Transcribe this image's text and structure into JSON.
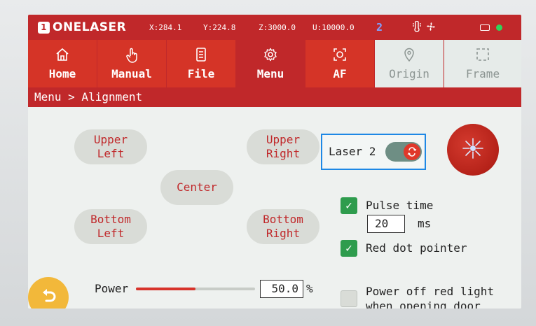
{
  "brand": {
    "logo_text": "ONELASER",
    "logo_badge": "1"
  },
  "status": {
    "x": "X:284.1",
    "y": "Y:224.8",
    "z": "Z:3000.0",
    "u": "U:10000.0",
    "laser_number": "2",
    "icons": [
      "temperature-icon",
      "fan-icon",
      "battery-icon",
      "connection-dot"
    ],
    "connection_color": "#2fd35a"
  },
  "tabs": [
    {
      "label": "Home",
      "icon": "home-icon"
    },
    {
      "label": "Manual",
      "icon": "hand-pointer-icon"
    },
    {
      "label": "File",
      "icon": "file-icon"
    },
    {
      "label": "Menu",
      "icon": "gear-icon",
      "active": true
    },
    {
      "label": "AF",
      "icon": "autofocus-icon"
    },
    {
      "label": "Origin",
      "icon": "location-pin-icon",
      "disabled": true
    },
    {
      "label": "Frame",
      "icon": "frame-icon",
      "disabled": true
    }
  ],
  "breadcrumb": "Menu > Alignment",
  "positions": {
    "upper_left": "Upper Left",
    "upper_right": "Upper Right",
    "center": "Center",
    "bottom_left": "Bottom Left",
    "bottom_right": "Bottom Right"
  },
  "laser_toggle": {
    "label": "Laser 2",
    "on": true
  },
  "fire_button": {
    "icon": "laser-burst-icon"
  },
  "options": {
    "pulse_time": {
      "label": "Pulse time",
      "checked": true,
      "value": "20",
      "unit": "ms"
    },
    "red_dot": {
      "label": "Red dot pointer",
      "checked": true
    },
    "power_off_light": {
      "label_line1": "Power off red light",
      "label_line2": "when opening door",
      "checked": false
    }
  },
  "power": {
    "label": "Power",
    "value": "50.0",
    "unit": "%",
    "fraction": 0.5
  },
  "colors": {
    "brand_red": "#c0282a",
    "accent_blue": "#1e88e5",
    "check_green": "#2e9c4d",
    "back_yellow": "#f2b83a"
  }
}
